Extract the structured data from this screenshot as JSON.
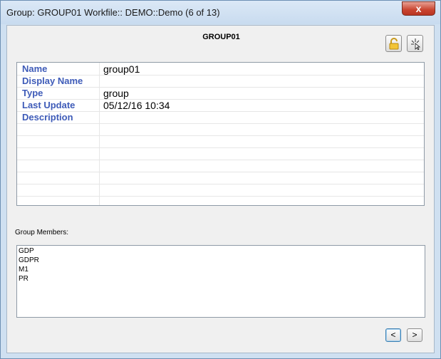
{
  "window": {
    "title": "Group: GROUP01 Workfile:: DEMO::Demo (6 of 13)",
    "close_glyph": "x"
  },
  "header": {
    "title": "GROUP01"
  },
  "toolbar": {
    "lock_icon": "lock-icon",
    "sparkle_icon": "sparkle-cursor-icon"
  },
  "properties": [
    {
      "label": "Name",
      "value": "group01"
    },
    {
      "label": "Display Name",
      "value": ""
    },
    {
      "label": "Type",
      "value": "group"
    },
    {
      "label": "Last Update",
      "value": "05/12/16  10:34"
    },
    {
      "label": "Description",
      "value": ""
    },
    {
      "label": "",
      "value": ""
    },
    {
      "label": "",
      "value": ""
    },
    {
      "label": "",
      "value": ""
    },
    {
      "label": "",
      "value": ""
    },
    {
      "label": "",
      "value": ""
    },
    {
      "label": "",
      "value": ""
    },
    {
      "label": "",
      "value": ""
    }
  ],
  "members": {
    "label": "Group Members:",
    "items": [
      "GDP",
      "GDPR",
      "M1",
      "PR"
    ]
  },
  "navigation": {
    "prev_label": "<",
    "next_label": ">"
  }
}
